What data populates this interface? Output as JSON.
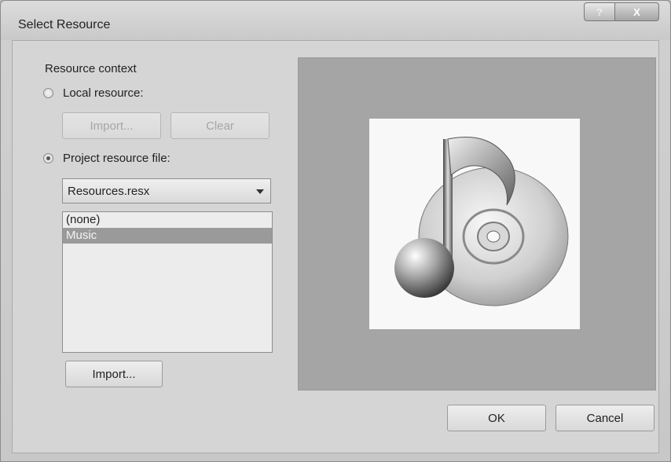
{
  "window": {
    "title": "Select Resource",
    "help_label": "?",
    "close_label": "X"
  },
  "context": {
    "group_label": "Resource context",
    "local_radio_label": "Local resource:",
    "import_local_label": "Import...",
    "clear_label": "Clear",
    "project_radio_label": "Project resource file:",
    "resource_file_selected": "Resources.resx",
    "resource_list": [
      "(none)",
      "Music"
    ],
    "selected_item": "Music",
    "import_button_label": "Import..."
  },
  "preview": {
    "image_icon": "music-note-cd-icon"
  },
  "footer": {
    "ok_label": "OK",
    "cancel_label": "Cancel"
  }
}
